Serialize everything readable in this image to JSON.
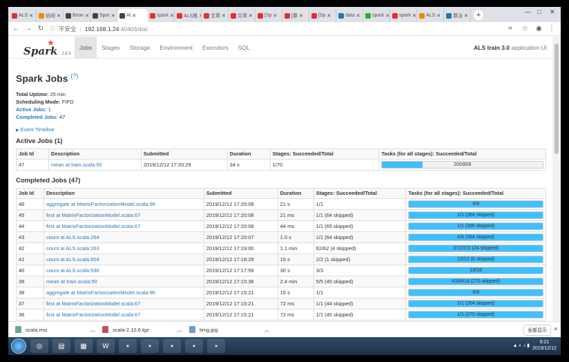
{
  "browser": {
    "tabs": [
      {
        "label": "ALS",
        "color": "#d33"
      },
      {
        "label": "协同",
        "color": "#e80"
      },
      {
        "label": "Brow",
        "color": "#444"
      },
      {
        "label": "Spar",
        "color": "#444"
      },
      {
        "label": "Al",
        "color": "#444",
        "active": true
      },
      {
        "label": "spark",
        "color": "#d33"
      },
      {
        "label": "ALS推",
        "color": "#d33"
      },
      {
        "label": "文章",
        "color": "#d33"
      },
      {
        "label": "文章",
        "color": "#d33"
      },
      {
        "label": "[Sp",
        "color": "#d33"
      },
      {
        "label": "[算",
        "color": "#d33"
      },
      {
        "label": "[Sp",
        "color": "#d33"
      },
      {
        "label": "data",
        "color": "#27a"
      },
      {
        "label": "spark",
        "color": "#3a3"
      },
      {
        "label": "spark",
        "color": "#d33"
      },
      {
        "label": "ALS",
        "color": "#e80"
      },
      {
        "label": "算法",
        "color": "#27a"
      }
    ],
    "address": {
      "security": "不安全",
      "host": "192.168.1.24",
      "path": ":4040/jobs/"
    }
  },
  "spark": {
    "version": "1.6.3",
    "nav_tabs": [
      "Jobs",
      "Stages",
      "Storage",
      "Environment",
      "Executors",
      "SQL"
    ],
    "app_name": "ALS train 3.0",
    "app_suffix": "application UI"
  },
  "page": {
    "title": "Spark Jobs",
    "help": "(?)",
    "summary": {
      "uptime_label": "Total Uptime:",
      "uptime": "25 min",
      "mode_label": "Scheduling Mode:",
      "mode": "FIFO",
      "active_label": "Active Jobs:",
      "active": "1",
      "completed_label": "Completed Jobs:",
      "completed": "47"
    },
    "event_timeline": "Event Timeline",
    "active_title": "Active Jobs (1)",
    "completed_title": "Completed Jobs (47)",
    "columns": [
      "Job Id",
      "Description",
      "Submitted",
      "Duration",
      "Stages: Succeeded/Total",
      "Tasks (for all stages): Succeeded/Total"
    ],
    "active_jobs": [
      {
        "id": "47",
        "desc": "mean at train.scala:50",
        "submitted": "2019/12/12 17:20:29",
        "duration": "34 s",
        "stages": "1/70",
        "tasks": "200/808",
        "frac": 0.25
      }
    ],
    "completed_jobs": [
      {
        "id": "46",
        "desc": "aggregate at MatrixFactorizationModel.scala:96",
        "submitted": "2019/12/12 17:20:08",
        "duration": "21 s",
        "stages": "1/1",
        "tasks": "6/6",
        "frac": 1
      },
      {
        "id": "45",
        "desc": "first at MatrixFactorizationModel.scala:67",
        "submitted": "2019/12/12 17:20:08",
        "duration": "21 ms",
        "stages": "1/1 (64 skipped)",
        "tasks": "1/1 (384 skipped)",
        "frac": 1
      },
      {
        "id": "44",
        "desc": "first at MatrixFactorizationModel.scala:67",
        "submitted": "2019/12/12 17:20:08",
        "duration": "44 ms",
        "stages": "1/1 (65 skipped)",
        "tasks": "1/1 (390 skipped)",
        "frac": 1
      },
      {
        "id": "43",
        "desc": "count at ALS.scala:264",
        "submitted": "2019/12/12 17:20:07",
        "duration": "1.0 s",
        "stages": "1/1 (64 skipped)",
        "tasks": "6/6 (384 skipped)",
        "frac": 1
      },
      {
        "id": "42",
        "desc": "count at ALS.scala:263",
        "submitted": "2019/12/12 17:19:00",
        "duration": "1.1 min",
        "stages": "62/62 (4 skipped)",
        "tasks": "372/372 (24 skipped)",
        "frac": 1
      },
      {
        "id": "41",
        "desc": "count at ALS.scala:604",
        "submitted": "2019/12/12 17:18:29",
        "duration": "15 s",
        "stages": "2/2 (1 skipped)",
        "tasks": "12/12 (6 skipped)",
        "frac": 1
      },
      {
        "id": "40",
        "desc": "count at ALS.scala:596",
        "submitted": "2019/12/12 17:17:59",
        "duration": "30 s",
        "stages": "3/3",
        "tasks": "18/18",
        "frac": 1
      },
      {
        "id": "39",
        "desc": "mean at train.scala:50",
        "submitted": "2019/12/12 17:15:36",
        "duration": "2.4 min",
        "stages": "5/5 (45 skipped)",
        "tasks": "418/418 (270 skipped)",
        "frac": 1
      },
      {
        "id": "38",
        "desc": "aggregate at MatrixFactorizationModel.scala:96",
        "submitted": "2019/12/12 17:15:21",
        "duration": "15 s",
        "stages": "1/1",
        "tasks": "6/6",
        "frac": 1
      },
      {
        "id": "37",
        "desc": "first at MatrixFactorizationModel.scala:67",
        "submitted": "2019/12/12 17:15:21",
        "duration": "72 ms",
        "stages": "1/1 (44 skipped)",
        "tasks": "1/1 (264 skipped)",
        "frac": 1
      },
      {
        "id": "36",
        "desc": "first at MatrixFactorizationModel.scala:67",
        "submitted": "2019/12/12 17:15:21",
        "duration": "72 ms",
        "stages": "1/1 (45 skipped)",
        "tasks": "1/1 (270 skipped)",
        "frac": 1
      }
    ]
  },
  "downloads": {
    "items": [
      {
        "name": "scala.msi",
        "color": "#6a8"
      },
      {
        "name": "scala-2.10.6.tgz",
        "color": "#b55"
      },
      {
        "name": "timg.jpg",
        "color": "#79c"
      }
    ],
    "show_all": "全部显示"
  },
  "taskbar": {
    "apps": [
      "chrome",
      "folder",
      "office",
      "word",
      "app",
      "app",
      "app",
      "app",
      "app"
    ],
    "clock_time": "9:21",
    "clock_date": "2019/12/12"
  }
}
